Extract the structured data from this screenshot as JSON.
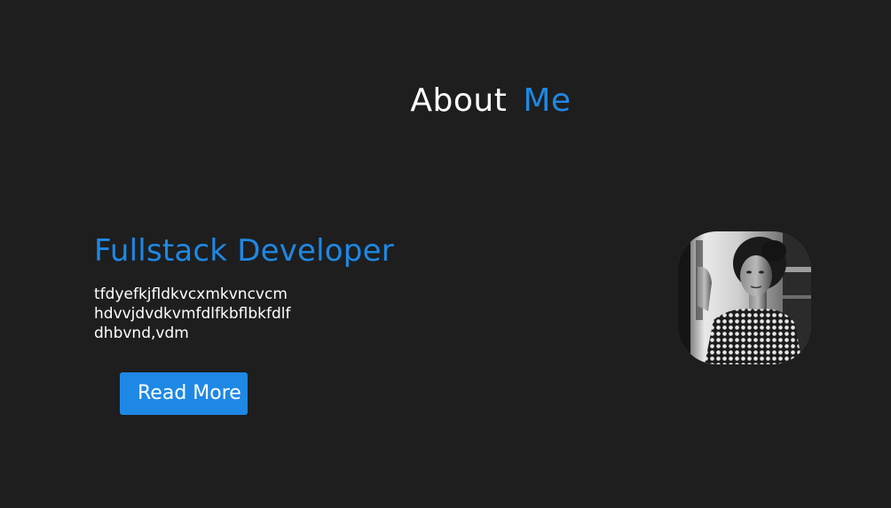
{
  "about": {
    "title_part1": "About",
    "title_part2": "Me",
    "accent_color": "#1e88e5",
    "background_color": "#1e1e1e"
  },
  "profile": {
    "role": "Fullstack Developer",
    "bio_lines": [
      "tfdyefkjfldkvcxmkvncvcm",
      "hdvvjdvdkvmfdlfkbflbkfdlf",
      "dhbvnd,vdm"
    ],
    "read_more_label": "Read More",
    "avatar_icon": "profile-photo"
  }
}
